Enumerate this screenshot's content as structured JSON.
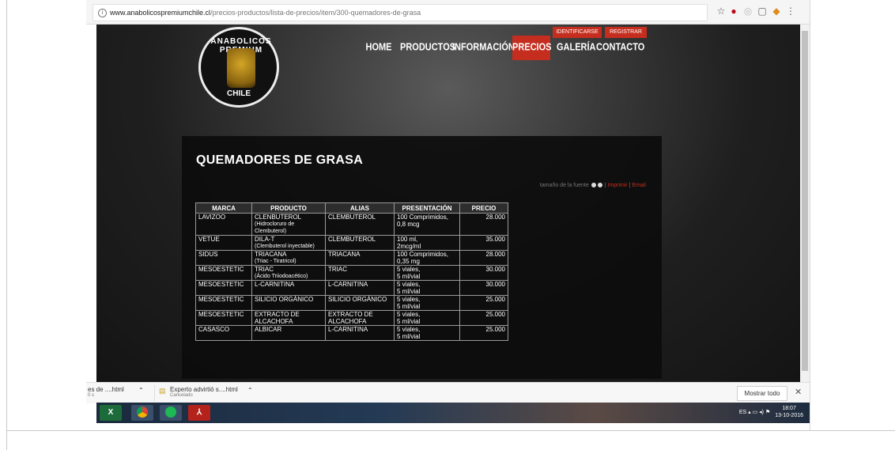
{
  "browser": {
    "url_host": "www.anabolicospremiumchile.cl",
    "url_path": "/precios-productos/lista-de-precios/item/300-quemadores-de-grasa",
    "icons": [
      "star-icon",
      "pinterest-icon",
      "extension-icon",
      "cast-icon",
      "extension-orange-icon",
      "menu-icon"
    ]
  },
  "site": {
    "logo_top": "ANABOLICOS PREMIUM",
    "logo_bottom": "CHILE",
    "top_buttons": [
      "IDENTIFICARSE",
      "REGISTRAR"
    ],
    "nav": [
      "HOME",
      "PRODUCTOS",
      "INFORMACIÓN",
      "PRECIOS",
      "GALERÍA",
      "CONTACTO"
    ],
    "active_nav": "PRECIOS",
    "accent_color": "#c52e1e"
  },
  "content": {
    "heading": "QUEMADORES DE GRASA",
    "font_size_label": "tamaño de la fuente",
    "print_label": "Imprimir",
    "email_label": "Email",
    "separator": "|"
  },
  "table": {
    "headers": [
      "MARCA",
      "PRODUCTO",
      "ALIAS",
      "PRESENTACIÓN",
      "PRECIO"
    ],
    "rows": [
      {
        "marca": "LAVIZOO",
        "producto": "CLENBUTEROL",
        "producto_sub": "(Hidrocloruro de Clembuterol)",
        "alias": "CLEMBUTEROL",
        "presentacion": "100 Comprimidos,",
        "presentacion_2": "0,8 mcg",
        "precio": "28.000"
      },
      {
        "marca": "VETUE",
        "producto": "DILA-T",
        "producto_sub": "(Clembuterol inyectable)",
        "alias": "CLEMBUTEROL",
        "presentacion": "100 ml,",
        "presentacion_2": "2mcg/ml",
        "precio": "35.000"
      },
      {
        "marca": "SIDUS",
        "producto": "TRIACANA",
        "producto_sub": "(Triac - Tiratricol)",
        "alias": "TRIACANA",
        "presentacion": "100 Comprimidos,",
        "presentacion_2": "0,35 mg",
        "precio": "28.000"
      },
      {
        "marca": "MESOESTETIC",
        "producto": "TRIAC",
        "producto_sub": "(Ácido Triiodoacético)",
        "alias": "TRIAC",
        "presentacion": "5 viales,",
        "presentacion_2": "5 ml/vial",
        "precio": "30.000"
      },
      {
        "marca": "MESOESTETIC",
        "producto": "L-CARNITINA",
        "producto_sub": "",
        "alias": "L-CARNITINA",
        "presentacion": "5 viales,",
        "presentacion_2": "5 ml/vial",
        "precio": "30.000"
      },
      {
        "marca": "MESOESTETIC",
        "producto": "SILICIO ORGÁNICO",
        "producto_sub": "",
        "alias": "SILICIO ORGÁNICO",
        "presentacion": "5 viales,",
        "presentacion_2": "5 ml/vial",
        "precio": "25.000"
      },
      {
        "marca": "MESOESTETIC",
        "producto": "EXTRACTO DE ALCACHOFA",
        "producto_sub": "",
        "alias": "EXTRACTO DE ALCACHOFA",
        "presentacion": "5 viales,",
        "presentacion_2": "5 ml/vial",
        "precio": "25.000"
      },
      {
        "marca": "CASASCO",
        "producto": "ALBICAR",
        "producto_sub": "",
        "alias": "L-CARNITINA",
        "presentacion": "5 viales,",
        "presentacion_2": "5 ml/vial",
        "precio": "25.000"
      }
    ]
  },
  "downloads": {
    "item1_name": "es de ....html",
    "item1_sub": "0 s",
    "item2_name": "Experto advirtió s....html",
    "item2_sub": "Cancelado",
    "show_all": "Mostrar todo",
    "close": "✕"
  },
  "taskbar": {
    "apps": [
      "excel-icon",
      "chrome-icon",
      "spotify-icon",
      "acrobat-icon"
    ],
    "lang": "ES",
    "time": "18:07",
    "date": "13-10-2016"
  }
}
